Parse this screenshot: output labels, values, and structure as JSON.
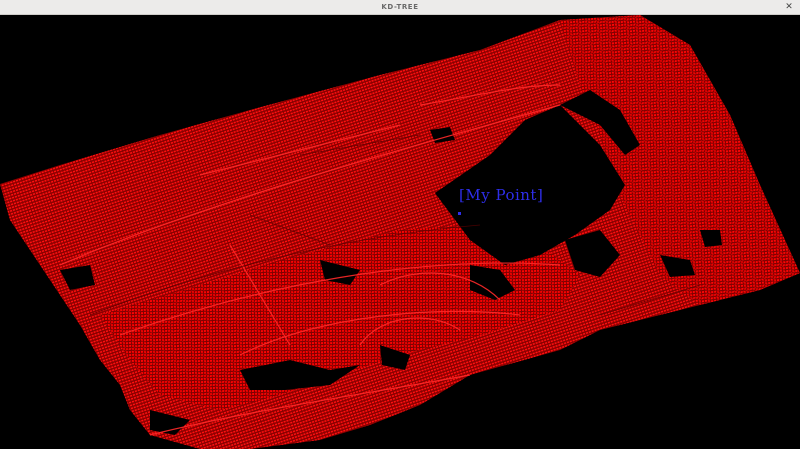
{
  "window": {
    "title": "KD-TREE",
    "close_glyph": "✕"
  },
  "viewer": {
    "background_color": "#000000",
    "point_color": "#ff0000",
    "label_color": "#2e2eea",
    "marker_color": "#2e2eea",
    "point_label": "[My Point]"
  }
}
